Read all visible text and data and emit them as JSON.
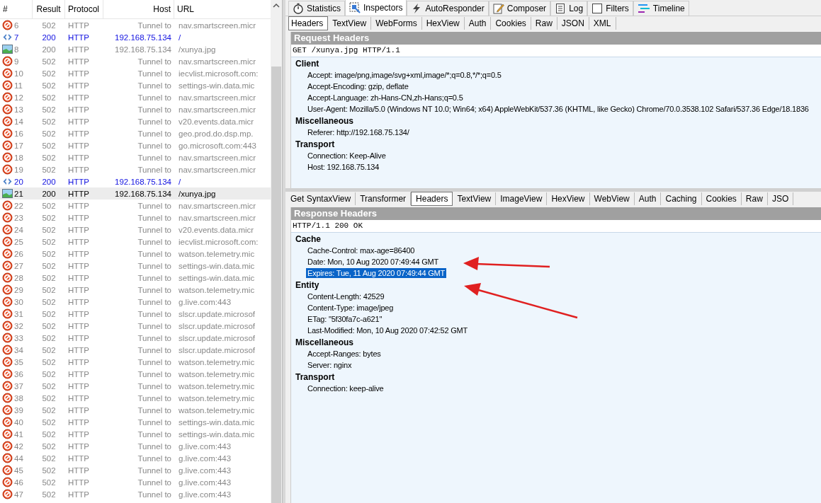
{
  "sessions": {
    "columns": [
      "#",
      "Result",
      "Protocol",
      "Host",
      "URL"
    ],
    "rows": [
      {
        "id": "6",
        "result": "502",
        "protocol": "HTTP",
        "host": "Tunnel to",
        "url": "nav.smartscreen.micr",
        "kind": "blocked",
        "selected": false
      },
      {
        "id": "7",
        "result": "200",
        "protocol": "HTTP",
        "host": "192.168.75.134",
        "url": "/",
        "kind": "html",
        "selected": false
      },
      {
        "id": "8",
        "result": "200",
        "protocol": "HTTP",
        "host": "192.168.75.134",
        "url": "/xunya.jpg",
        "kind": "image",
        "selected": false
      },
      {
        "id": "9",
        "result": "502",
        "protocol": "HTTP",
        "host": "Tunnel to",
        "url": "nav.smartscreen.micr",
        "kind": "blocked",
        "selected": false
      },
      {
        "id": "10",
        "result": "502",
        "protocol": "HTTP",
        "host": "Tunnel to",
        "url": "iecvlist.microsoft.com:",
        "kind": "blocked",
        "selected": false
      },
      {
        "id": "11",
        "result": "502",
        "protocol": "HTTP",
        "host": "Tunnel to",
        "url": "settings-win.data.mic",
        "kind": "blocked",
        "selected": false
      },
      {
        "id": "12",
        "result": "502",
        "protocol": "HTTP",
        "host": "Tunnel to",
        "url": "nav.smartscreen.micr",
        "kind": "blocked",
        "selected": false
      },
      {
        "id": "13",
        "result": "502",
        "protocol": "HTTP",
        "host": "Tunnel to",
        "url": "nav.smartscreen.micr",
        "kind": "blocked",
        "selected": false
      },
      {
        "id": "14",
        "result": "502",
        "protocol": "HTTP",
        "host": "Tunnel to",
        "url": "v20.events.data.micr",
        "kind": "blocked",
        "selected": false
      },
      {
        "id": "16",
        "result": "502",
        "protocol": "HTTP",
        "host": "Tunnel to",
        "url": "geo.prod.do.dsp.mp.",
        "kind": "blocked",
        "selected": false
      },
      {
        "id": "17",
        "result": "502",
        "protocol": "HTTP",
        "host": "Tunnel to",
        "url": "go.microsoft.com:443",
        "kind": "blocked",
        "selected": false
      },
      {
        "id": "18",
        "result": "502",
        "protocol": "HTTP",
        "host": "Tunnel to",
        "url": "nav.smartscreen.micr",
        "kind": "blocked",
        "selected": false
      },
      {
        "id": "19",
        "result": "502",
        "protocol": "HTTP",
        "host": "Tunnel to",
        "url": "nav.smartscreen.micr",
        "kind": "blocked",
        "selected": false
      },
      {
        "id": "20",
        "result": "200",
        "protocol": "HTTP",
        "host": "192.168.75.134",
        "url": "/",
        "kind": "html",
        "selected": false
      },
      {
        "id": "21",
        "result": "200",
        "protocol": "HTTP",
        "host": "192.168.75.134",
        "url": "/xunya.jpg",
        "kind": "image",
        "selected": true
      },
      {
        "id": "22",
        "result": "502",
        "protocol": "HTTP",
        "host": "Tunnel to",
        "url": "nav.smartscreen.micr",
        "kind": "blocked",
        "selected": false
      },
      {
        "id": "23",
        "result": "502",
        "protocol": "HTTP",
        "host": "Tunnel to",
        "url": "nav.smartscreen.micr",
        "kind": "blocked",
        "selected": false
      },
      {
        "id": "24",
        "result": "502",
        "protocol": "HTTP",
        "host": "Tunnel to",
        "url": "v20.events.data.micr",
        "kind": "blocked",
        "selected": false
      },
      {
        "id": "25",
        "result": "502",
        "protocol": "HTTP",
        "host": "Tunnel to",
        "url": "iecvlist.microsoft.com:",
        "kind": "blocked",
        "selected": false
      },
      {
        "id": "26",
        "result": "502",
        "protocol": "HTTP",
        "host": "Tunnel to",
        "url": "watson.telemetry.mic",
        "kind": "blocked",
        "selected": false
      },
      {
        "id": "27",
        "result": "502",
        "protocol": "HTTP",
        "host": "Tunnel to",
        "url": "settings-win.data.mic",
        "kind": "blocked",
        "selected": false
      },
      {
        "id": "28",
        "result": "502",
        "protocol": "HTTP",
        "host": "Tunnel to",
        "url": "settings-win.data.mic",
        "kind": "blocked",
        "selected": false
      },
      {
        "id": "29",
        "result": "502",
        "protocol": "HTTP",
        "host": "Tunnel to",
        "url": "watson.telemetry.mic",
        "kind": "blocked",
        "selected": false
      },
      {
        "id": "30",
        "result": "502",
        "protocol": "HTTP",
        "host": "Tunnel to",
        "url": "g.live.com:443",
        "kind": "blocked",
        "selected": false
      },
      {
        "id": "31",
        "result": "502",
        "protocol": "HTTP",
        "host": "Tunnel to",
        "url": "slscr.update.microsof",
        "kind": "blocked",
        "selected": false
      },
      {
        "id": "32",
        "result": "502",
        "protocol": "HTTP",
        "host": "Tunnel to",
        "url": "slscr.update.microsof",
        "kind": "blocked",
        "selected": false
      },
      {
        "id": "33",
        "result": "502",
        "protocol": "HTTP",
        "host": "Tunnel to",
        "url": "slscr.update.microsof",
        "kind": "blocked",
        "selected": false
      },
      {
        "id": "34",
        "result": "502",
        "protocol": "HTTP",
        "host": "Tunnel to",
        "url": "slscr.update.microsof",
        "kind": "blocked",
        "selected": false
      },
      {
        "id": "35",
        "result": "502",
        "protocol": "HTTP",
        "host": "Tunnel to",
        "url": "watson.telemetry.mic",
        "kind": "blocked",
        "selected": false
      },
      {
        "id": "36",
        "result": "502",
        "protocol": "HTTP",
        "host": "Tunnel to",
        "url": "watson.telemetry.mic",
        "kind": "blocked",
        "selected": false
      },
      {
        "id": "37",
        "result": "502",
        "protocol": "HTTP",
        "host": "Tunnel to",
        "url": "watson.telemetry.mic",
        "kind": "blocked",
        "selected": false
      },
      {
        "id": "38",
        "result": "502",
        "protocol": "HTTP",
        "host": "Tunnel to",
        "url": "watson.telemetry.mic",
        "kind": "blocked",
        "selected": false
      },
      {
        "id": "39",
        "result": "502",
        "protocol": "HTTP",
        "host": "Tunnel to",
        "url": "watson.telemetry.mic",
        "kind": "blocked",
        "selected": false
      },
      {
        "id": "40",
        "result": "502",
        "protocol": "HTTP",
        "host": "Tunnel to",
        "url": "settings-win.data.mic",
        "kind": "blocked",
        "selected": false
      },
      {
        "id": "41",
        "result": "502",
        "protocol": "HTTP",
        "host": "Tunnel to",
        "url": "settings-win.data.mic",
        "kind": "blocked",
        "selected": false
      },
      {
        "id": "42",
        "result": "502",
        "protocol": "HTTP",
        "host": "Tunnel to",
        "url": "g.live.com:443",
        "kind": "blocked",
        "selected": false
      },
      {
        "id": "44",
        "result": "502",
        "protocol": "HTTP",
        "host": "Tunnel to",
        "url": "g.live.com:443",
        "kind": "blocked",
        "selected": false
      },
      {
        "id": "45",
        "result": "502",
        "protocol": "HTTP",
        "host": "Tunnel to",
        "url": "g.live.com:443",
        "kind": "blocked",
        "selected": false
      },
      {
        "id": "46",
        "result": "502",
        "protocol": "HTTP",
        "host": "Tunnel to",
        "url": "g.live.com:443",
        "kind": "blocked",
        "selected": false
      },
      {
        "id": "47",
        "result": "502",
        "protocol": "HTTP",
        "host": "Tunnel to",
        "url": "g.live.com:443",
        "kind": "blocked",
        "selected": false
      }
    ]
  },
  "tabs": [
    {
      "label": "Statistics",
      "selected": false
    },
    {
      "label": "Inspectors",
      "selected": true
    },
    {
      "label": "AutoResponder",
      "selected": false
    },
    {
      "label": "Composer",
      "selected": false
    },
    {
      "label": "Log",
      "selected": false
    },
    {
      "label": "Filters",
      "selected": false
    },
    {
      "label": "Timeline",
      "selected": false
    }
  ],
  "request": {
    "tabs": [
      {
        "label": "Headers",
        "selected": true
      },
      {
        "label": "TextView",
        "selected": false
      },
      {
        "label": "WebForms",
        "selected": false
      },
      {
        "label": "HexView",
        "selected": false
      },
      {
        "label": "Auth",
        "selected": false
      },
      {
        "label": "Cookies",
        "selected": false
      },
      {
        "label": "Raw",
        "selected": false
      },
      {
        "label": "JSON",
        "selected": false
      },
      {
        "label": "XML",
        "selected": false
      }
    ],
    "title": "Request Headers",
    "line": "GET /xunya.jpg HTTP/1.1",
    "groups": [
      {
        "name": "Client",
        "headers": [
          {
            "text": "Accept: image/png,image/svg+xml,image/*;q=0.8,*/*;q=0.5",
            "selected": false
          },
          {
            "text": "Accept-Encoding: gzip, deflate",
            "selected": false
          },
          {
            "text": "Accept-Language: zh-Hans-CN,zh-Hans;q=0.5",
            "selected": false
          },
          {
            "text": "User-Agent: Mozilla/5.0 (Windows NT 10.0; Win64; x64) AppleWebKit/537.36 (KHTML, like Gecko) Chrome/70.0.3538.102 Safari/537.36 Edge/18.1836",
            "selected": false
          }
        ]
      },
      {
        "name": "Miscellaneous",
        "headers": [
          {
            "text": "Referer: http://192.168.75.134/",
            "selected": false
          }
        ]
      },
      {
        "name": "Transport",
        "headers": [
          {
            "text": "Connection: Keep-Alive",
            "selected": false
          },
          {
            "text": "Host: 192.168.75.134",
            "selected": false
          }
        ]
      }
    ]
  },
  "response": {
    "tabs": [
      {
        "label": "Get SyntaxView",
        "selected": false
      },
      {
        "label": "Transformer",
        "selected": false
      },
      {
        "label": "Headers",
        "selected": true
      },
      {
        "label": "TextView",
        "selected": false
      },
      {
        "label": "ImageView",
        "selected": false
      },
      {
        "label": "HexView",
        "selected": false
      },
      {
        "label": "WebView",
        "selected": false
      },
      {
        "label": "Auth",
        "selected": false
      },
      {
        "label": "Caching",
        "selected": false
      },
      {
        "label": "Cookies",
        "selected": false
      },
      {
        "label": "Raw",
        "selected": false
      },
      {
        "label": "JSO",
        "selected": false
      }
    ],
    "title": "Response Headers",
    "line": "HTTP/1.1 200 OK",
    "groups": [
      {
        "name": "Cache",
        "headers": [
          {
            "text": "Cache-Control: max-age=86400",
            "selected": false
          },
          {
            "text": "Date: Mon, 10 Aug 2020 07:49:44 GMT",
            "selected": false
          },
          {
            "text": "Expires: Tue, 11 Aug 2020 07:49:44 GMT",
            "selected": true
          }
        ]
      },
      {
        "name": "Entity",
        "headers": [
          {
            "text": "Content-Length: 42529",
            "selected": false
          },
          {
            "text": "Content-Type: image/jpeg",
            "selected": false
          },
          {
            "text": "ETag: \"5f30fa7c-a621\"",
            "selected": false
          },
          {
            "text": "Last-Modified: Mon, 10 Aug 2020 07:42:52 GMT",
            "selected": false
          }
        ]
      },
      {
        "name": "Miscellaneous",
        "headers": [
          {
            "text": "Accept-Ranges: bytes",
            "selected": false
          },
          {
            "text": "Server: nginx",
            "selected": false
          }
        ]
      },
      {
        "name": "Transport",
        "headers": [
          {
            "text": "Connection: keep-alive",
            "selected": false
          }
        ]
      }
    ]
  }
}
